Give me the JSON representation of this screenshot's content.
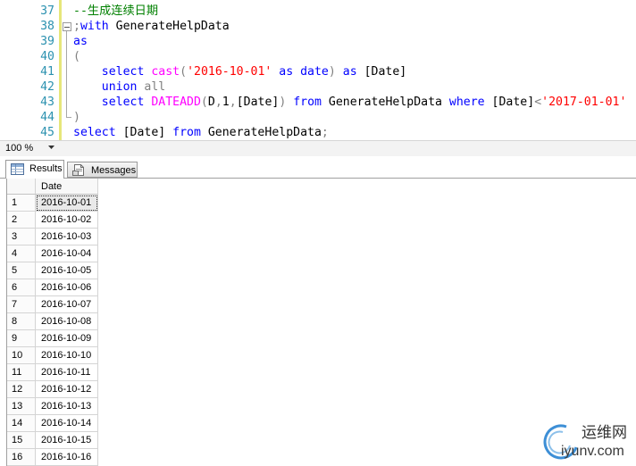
{
  "colors": {
    "keyword": "#0000ff",
    "function": "#ff00ff",
    "string": "#ff0000",
    "comment": "#008000",
    "punct": "#808080",
    "plain": "#000000",
    "line_number": "#2b91af",
    "change_bar": "#e6e67a",
    "watermark_accent": "#3d8fd6"
  },
  "editor": {
    "zoom": "100 %",
    "lines": [
      {
        "num": "37",
        "tokens": [
          {
            "t": "--生成连续日期",
            "k": "comment"
          }
        ]
      },
      {
        "num": "38",
        "tokens": [
          {
            "t": ";",
            "k": "punct"
          },
          {
            "t": "with",
            "k": "keyword"
          },
          {
            "t": " GenerateHelpData",
            "k": "plain"
          }
        ]
      },
      {
        "num": "39",
        "tokens": [
          {
            "t": "as",
            "k": "keyword"
          }
        ]
      },
      {
        "num": "40",
        "tokens": [
          {
            "t": "(",
            "k": "punct"
          }
        ]
      },
      {
        "num": "41",
        "tokens": [
          {
            "t": "    select ",
            "k": "keyword"
          },
          {
            "t": "cast",
            "k": "function"
          },
          {
            "t": "(",
            "k": "punct"
          },
          {
            "t": "'2016-10-01'",
            "k": "string"
          },
          {
            "t": " as date",
            "k": "keyword"
          },
          {
            "t": ")",
            "k": "punct"
          },
          {
            "t": " as ",
            "k": "keyword"
          },
          {
            "t": "[Date]",
            "k": "plain"
          }
        ]
      },
      {
        "num": "42",
        "tokens": [
          {
            "t": "    union ",
            "k": "keyword"
          },
          {
            "t": "all",
            "k": "punct"
          }
        ]
      },
      {
        "num": "43",
        "tokens": [
          {
            "t": "    select ",
            "k": "keyword"
          },
          {
            "t": "DATEADD",
            "k": "function"
          },
          {
            "t": "(",
            "k": "punct"
          },
          {
            "t": "D",
            "k": "plain"
          },
          {
            "t": ",",
            "k": "punct"
          },
          {
            "t": "1",
            "k": "plain"
          },
          {
            "t": ",",
            "k": "punct"
          },
          {
            "t": "[Date]",
            "k": "plain"
          },
          {
            "t": ")",
            "k": "punct"
          },
          {
            "t": " from ",
            "k": "keyword"
          },
          {
            "t": "GenerateHelpData",
            "k": "plain"
          },
          {
            "t": " where ",
            "k": "keyword"
          },
          {
            "t": "[Date]",
            "k": "plain"
          },
          {
            "t": "<",
            "k": "punct"
          },
          {
            "t": "'2017-01-01'",
            "k": "string"
          }
        ]
      },
      {
        "num": "44",
        "tokens": [
          {
            "t": ")",
            "k": "punct"
          }
        ]
      },
      {
        "num": "45",
        "tokens": [
          {
            "t": "select ",
            "k": "keyword"
          },
          {
            "t": "[Date]",
            "k": "plain"
          },
          {
            "t": " from ",
            "k": "keyword"
          },
          {
            "t": "GenerateHelpData",
            "k": "plain"
          },
          {
            "t": ";",
            "k": "punct"
          }
        ]
      }
    ]
  },
  "tabs": [
    {
      "label": "Results",
      "icon": "grid-icon",
      "selected": true
    },
    {
      "label": "Messages",
      "icon": "messages-icon",
      "selected": false
    }
  ],
  "grid": {
    "columns": [
      "Date"
    ],
    "selected_row": 1,
    "rows": [
      {
        "n": "1",
        "date": "2016-10-01"
      },
      {
        "n": "2",
        "date": "2016-10-02"
      },
      {
        "n": "3",
        "date": "2016-10-03"
      },
      {
        "n": "4",
        "date": "2016-10-04"
      },
      {
        "n": "5",
        "date": "2016-10-05"
      },
      {
        "n": "6",
        "date": "2016-10-06"
      },
      {
        "n": "7",
        "date": "2016-10-07"
      },
      {
        "n": "8",
        "date": "2016-10-08"
      },
      {
        "n": "9",
        "date": "2016-10-09"
      },
      {
        "n": "10",
        "date": "2016-10-10"
      },
      {
        "n": "11",
        "date": "2016-10-11"
      },
      {
        "n": "12",
        "date": "2016-10-12"
      },
      {
        "n": "13",
        "date": "2016-10-13"
      },
      {
        "n": "14",
        "date": "2016-10-14"
      },
      {
        "n": "15",
        "date": "2016-10-15"
      },
      {
        "n": "16",
        "date": "2016-10-16"
      }
    ]
  },
  "watermark": {
    "cn": "运维网",
    "en": "iyunv.com"
  }
}
